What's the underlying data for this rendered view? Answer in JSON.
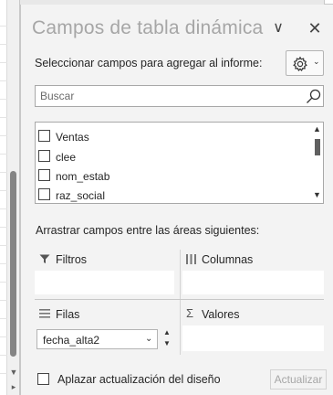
{
  "pane": {
    "title": "Campos de tabla dinámica",
    "chevron_glyph": "∨",
    "close_glyph": "✕",
    "instruction": "Seleccionar campos para agregar al informe:",
    "tools_icon": "gear-icon"
  },
  "search": {
    "placeholder": "Buscar",
    "value": ""
  },
  "fields": [
    {
      "label": "Ventas",
      "checked": false
    },
    {
      "label": "clee",
      "checked": false
    },
    {
      "label": "nom_estab",
      "checked": false
    },
    {
      "label": "raz_social",
      "checked": false
    }
  ],
  "areas": {
    "instruction": "Arrastrar campos entre las áreas siguientes:",
    "filters": {
      "label": "Filtros",
      "icon": "filter-icon"
    },
    "columns": {
      "label": "Columnas",
      "icon": "columns-icon"
    },
    "rows": {
      "label": "Filas",
      "icon": "rows-icon",
      "items": [
        "fecha_alta2"
      ]
    },
    "values": {
      "label": "Valores",
      "icon": "sigma-icon",
      "glyph": "Σ"
    }
  },
  "footer": {
    "defer_label": "Aplazar actualización del diseño",
    "defer_checked": false,
    "update_label": "Actualizar"
  },
  "colors": {
    "title": "#a6a6a6",
    "pane_bg": "#f3f3f3",
    "disabled_text": "#a6a6a6"
  }
}
